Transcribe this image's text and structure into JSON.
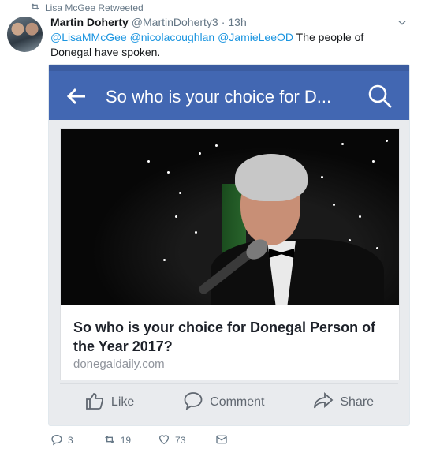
{
  "retweet_header": {
    "text": "Lisa McGee Retweeted"
  },
  "tweet": {
    "name": "Martin Doherty",
    "handle": "@MartinDoherty3",
    "separator": "·",
    "time": "13h",
    "text": {
      "mention1": "@LisaMMcGee",
      "mention2": "@nicolacoughlan",
      "mention3": "@JamieLeeOD",
      "body": "The people of Donegal have spoken."
    }
  },
  "fb_screenshot": {
    "bar_title": "So who is your choice for D...",
    "headline": "So who is your choice for Donegal Person of the Year 2017?",
    "domain": "donegaldaily.com",
    "actions": {
      "like": "Like",
      "comment": "Comment",
      "share": "Share"
    }
  },
  "tweet_actions": {
    "replies": "3",
    "retweets": "19",
    "likes": "73"
  },
  "colors": {
    "facebook_blue": "#4267b2",
    "link_blue": "#1b95e0",
    "muted": "#657786"
  },
  "icons": [
    "retweet-icon",
    "chevron-down-icon",
    "back-arrow-icon",
    "search-icon",
    "like-icon",
    "comment-icon",
    "share-icon",
    "reply-icon",
    "heart-icon",
    "message-icon"
  ]
}
